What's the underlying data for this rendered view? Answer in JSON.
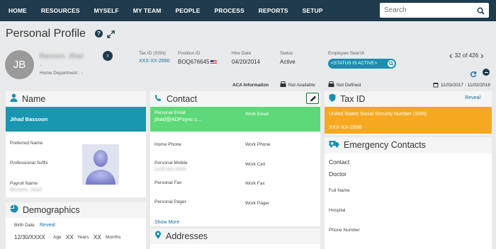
{
  "nav": {
    "items": [
      "HOME",
      "RESOURCES",
      "MYSELF",
      "MY TEAM",
      "PEOPLE",
      "PROCESS",
      "REPORTS",
      "SETUP"
    ],
    "search_placeholder": "Search"
  },
  "page": {
    "title": "Personal Profile"
  },
  "profile": {
    "initials": "JB",
    "name": "Bassoon, Jihad",
    "dot": "-",
    "home_department": "Home Department : -",
    "tax_id_label": "Tax ID (SSN)",
    "tax_id_value": "XXX-XX-2890",
    "position_id_label": "Position ID",
    "position_id_value": "BOQ676645",
    "hire_date_label": "Hire Date",
    "hire_date_value": "04/20/2014",
    "status_label": "Status",
    "status_value": "Active",
    "employee_search_label": "Employee Search",
    "status_filter": "<STATUS IS ACTIVE>",
    "pager_text": "32 of 426"
  },
  "infobar": {
    "aca_label": "ACA Information",
    "not_available": "Not Available",
    "not_defined": "Not Defined",
    "date_range": "11/03/2017 - 11/02/2018"
  },
  "name_panel": {
    "title": "Name",
    "full_name": "Jihad Bassoon",
    "preferred_name": "Preferred Name",
    "professional_suffix": "Professional Suffix",
    "payroll_name": "Payroll Name",
    "payroll_name_value": "Bassoon, Jihad"
  },
  "demographics": {
    "title": "Demographics",
    "birth_date_label": "Birth Date",
    "reveal": "Reveal",
    "birth_date_value": "12/30/XXXX",
    "age_label": "Age",
    "age_value": "XX",
    "years_label": "Years",
    "months_value": "XX",
    "months_label": "Months"
  },
  "contact": {
    "title": "Contact",
    "personal_email_label": "Personal Email",
    "personal_email_value": "jihad@ADPsync.c...",
    "work_email_label": "Work Email",
    "home_phone": "Home Phone",
    "work_phone": "Work Phone",
    "personal_mobile": "Personal Mobile",
    "personal_mobile_value": "(218) 601-9059",
    "work_cell": "Work Cell",
    "personal_fax": "Personal Fax",
    "work_fax": "Work Fax",
    "personal_pager": "Personal Pager",
    "work_pager": "Work Pager",
    "show_more": "Show More"
  },
  "addresses": {
    "title": "Addresses"
  },
  "tax_panel": {
    "title": "Tax ID",
    "reveal": "Reveal",
    "ssn_label": "United States Social Security Number (SSN)",
    "ssn_value": "XXX-XX-2890"
  },
  "emergency": {
    "title": "Emergency Contacts",
    "contact": "Contact",
    "relationship": "Doctor",
    "full_name": "Full Name",
    "hospital": "Hospital",
    "phone": "Phone Number"
  },
  "colors": {
    "nav_bg": "#1f3b4d",
    "name_band": "#1997b0",
    "contact_band": "#5ed979",
    "tax_band": "#f6a821",
    "accent": "#1a8fb0"
  }
}
